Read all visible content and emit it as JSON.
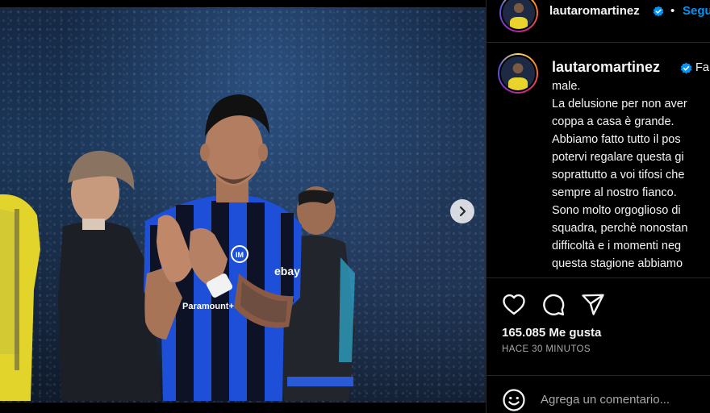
{
  "post": {
    "username": "lautaromartinez",
    "follow_label": "Segu",
    "dot": "•",
    "caption_lines": [
      "Fa",
      "male.",
      "La delusione per non aver",
      "coppa a casa è grande.",
      "Abbiamo fatto tutto il pos",
      "potervi regalare questa gi",
      "soprattutto a voi tifosi che",
      "sempre al nostro fianco.",
      "Sono molto orgoglioso di",
      "squadra, perchè nonostan",
      "difficoltà e i momenti neg",
      "questa stagione abbiamo"
    ],
    "likes": "165.085 Me gusta",
    "time_ago": "HACE 30 MINUTOS",
    "comment_placeholder": "Agrega un comentario..."
  },
  "photo": {
    "jersey_sponsor": "ebay",
    "jersey_sponsor2": "Paramount+"
  },
  "icons": {
    "verified": "verified-badge-icon",
    "next": "chevron-right-icon",
    "like": "heart-icon",
    "comment": "comment-bubble-icon",
    "share": "paper-plane-icon",
    "emoji": "smiley-icon"
  },
  "colors": {
    "verified_blue": "#0095f6",
    "follow_blue": "#0095f6",
    "jersey_blue": "#1d4fd8",
    "background": "#000000"
  }
}
